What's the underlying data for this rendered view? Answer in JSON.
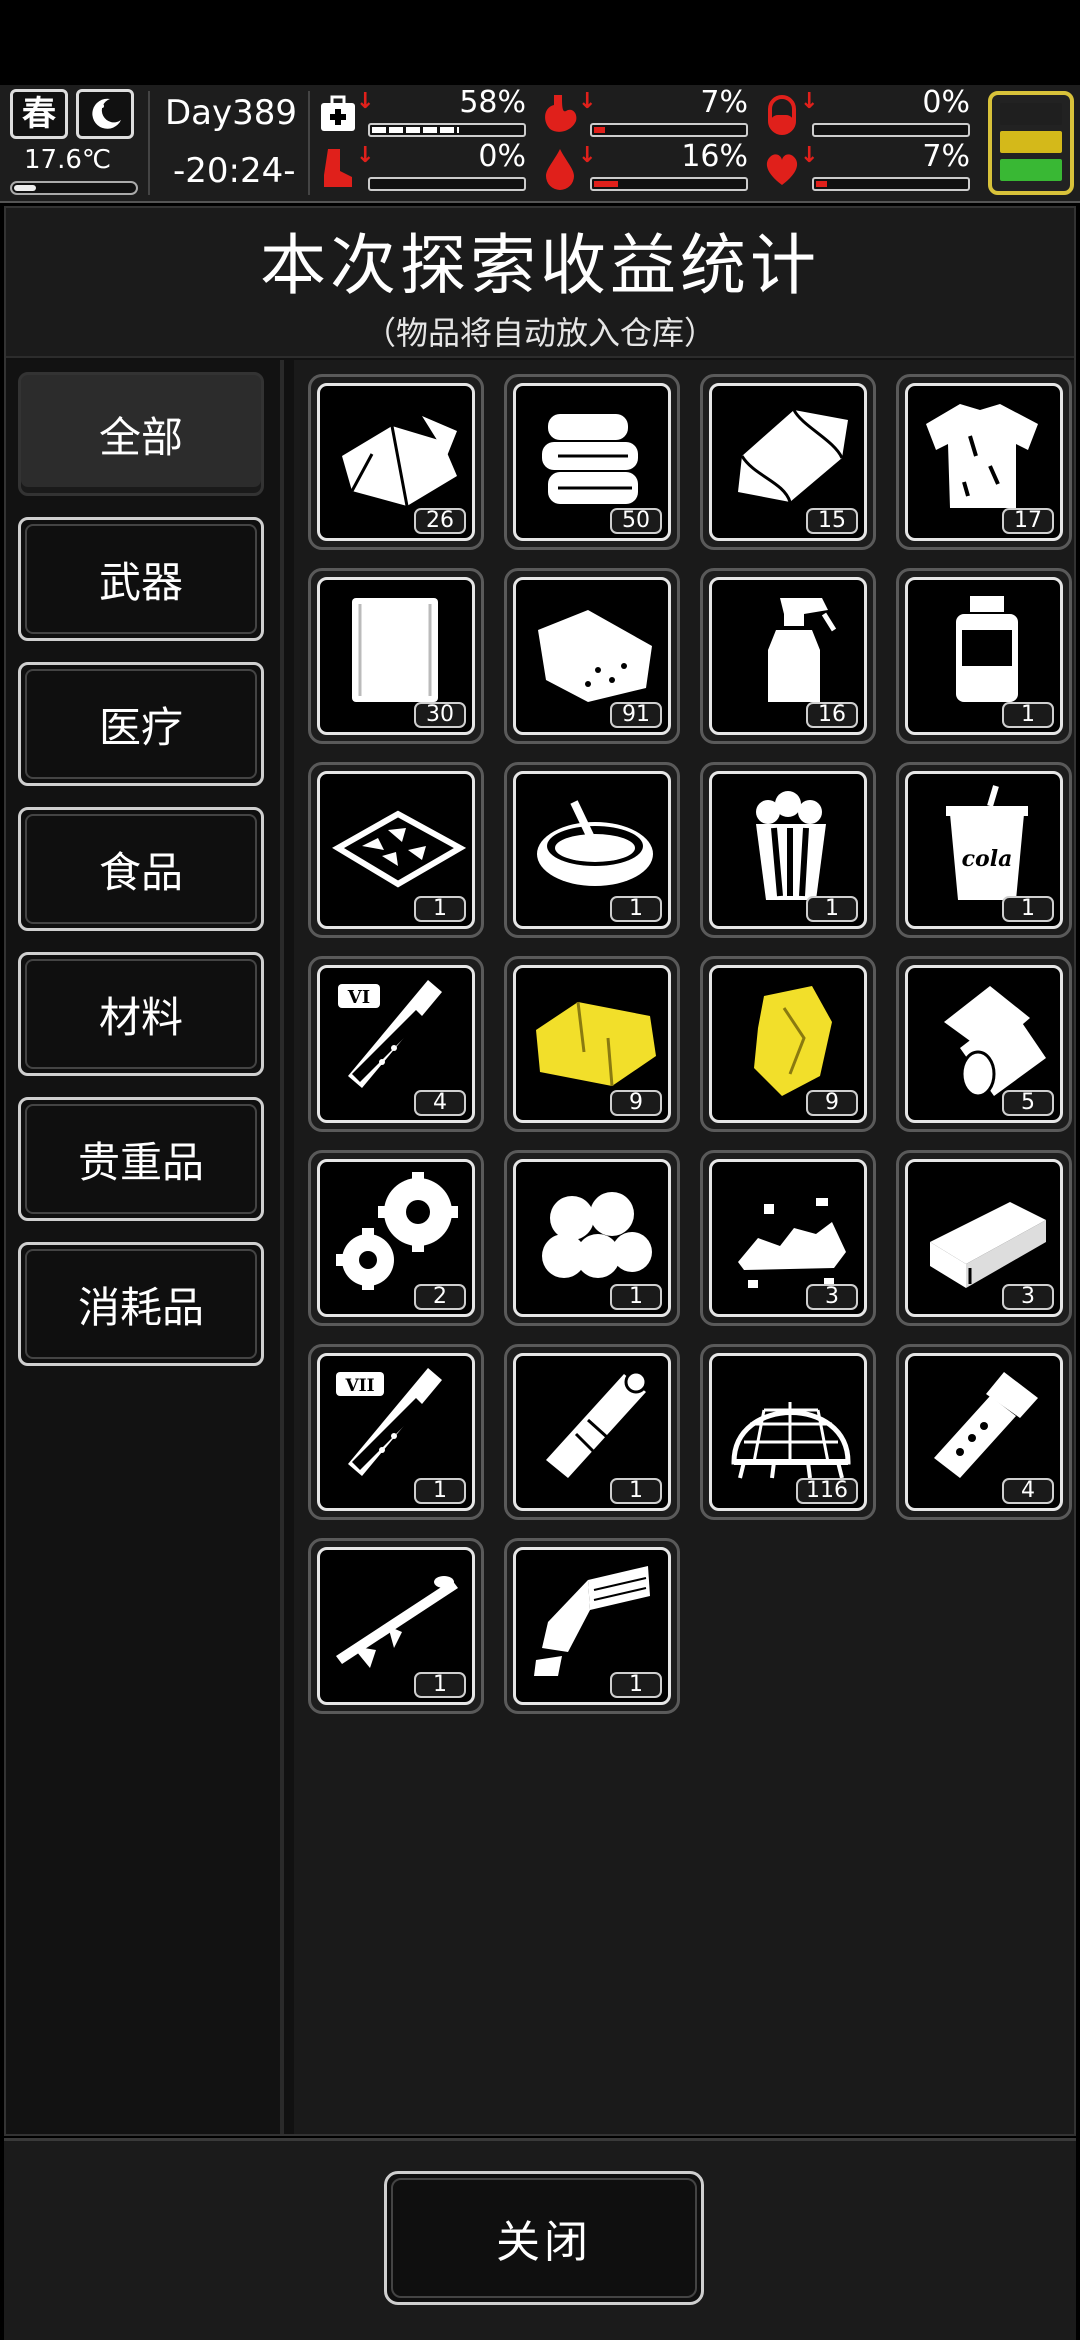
{
  "status": {
    "season": "春",
    "temperature": "17.6℃",
    "temperature_level": 0.18,
    "day": "Day389",
    "time": "-20:24-",
    "stats": [
      {
        "name": "health",
        "icon": "first-aid-kit-icon",
        "value": "58%",
        "fraction": 0.58,
        "color": "#ffffff"
      },
      {
        "name": "hunger",
        "icon": "stomach-icon",
        "value": "7%",
        "fraction": 0.07,
        "color": "#e0201b"
      },
      {
        "name": "medicine",
        "icon": "pill-icon",
        "value": "0%",
        "fraction": 0.0,
        "color": "#e0201b"
      },
      {
        "name": "stamina",
        "icon": "boot-icon",
        "value": "0%",
        "fraction": 0.0,
        "color": "#e0201b"
      },
      {
        "name": "thirst",
        "icon": "water-drop-icon",
        "value": "16%",
        "fraction": 0.16,
        "color": "#e0201b"
      },
      {
        "name": "mood",
        "icon": "heart-icon",
        "value": "7%",
        "fraction": 0.07,
        "color": "#e0201b"
      }
    ],
    "battery_colors": [
      "#1f1f1f",
      "#d4b91a",
      "#39b834"
    ]
  },
  "header": {
    "title": "本次探索收益统计",
    "subtitle": "（物品将自动放入仓库）"
  },
  "categories": [
    "全部",
    "武器",
    "医疗",
    "食品",
    "材料",
    "贵重品",
    "消耗品"
  ],
  "active_category": 0,
  "items": [
    {
      "icon": "cloth-rags-icon",
      "qty": "26"
    },
    {
      "icon": "folded-towels-icon",
      "qty": "50"
    },
    {
      "icon": "folded-cloth-icon",
      "qty": "15"
    },
    {
      "icon": "torn-shirt-icon",
      "qty": "17"
    },
    {
      "icon": "paper-sheets-icon",
      "qty": "30"
    },
    {
      "icon": "stuffed-bag-icon",
      "qty": "91"
    },
    {
      "icon": "spray-bottle-icon",
      "qty": "16"
    },
    {
      "icon": "medicine-bottle-icon",
      "qty": "1"
    },
    {
      "icon": "snack-tray-icon",
      "qty": "1"
    },
    {
      "icon": "soup-bowl-icon",
      "qty": "1"
    },
    {
      "icon": "popcorn-icon",
      "qty": "1"
    },
    {
      "icon": "cola-cup-icon",
      "qty": "1"
    },
    {
      "icon": "test-tube-vi-icon",
      "qty": "4"
    },
    {
      "icon": "yellow-cloth-icon",
      "qty": "9"
    },
    {
      "icon": "gold-nugget-icon",
      "qty": "9"
    },
    {
      "icon": "paper-roll-icon",
      "qty": "5"
    },
    {
      "icon": "gears-icon",
      "qty": "2"
    },
    {
      "icon": "cotton-balls-icon",
      "qty": "1"
    },
    {
      "icon": "rubble-pile-icon",
      "qty": "3"
    },
    {
      "icon": "metal-bar-icon",
      "qty": "3"
    },
    {
      "icon": "test-tube-vii-icon",
      "qty": "1"
    },
    {
      "icon": "bandage-roll-icon",
      "qty": "1"
    },
    {
      "icon": "net-trap-icon",
      "qty": "116"
    },
    {
      "icon": "flashlight-icon",
      "qty": "4"
    },
    {
      "icon": "rocket-launcher-icon",
      "qty": "1"
    },
    {
      "icon": "minigun-icon",
      "qty": "1"
    }
  ],
  "footer": {
    "close_label": "关闭"
  }
}
